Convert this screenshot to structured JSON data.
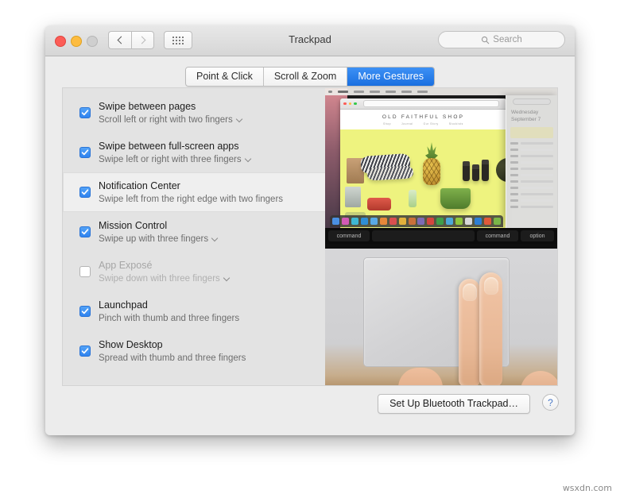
{
  "window": {
    "title": "Trackpad",
    "traffic_lights": [
      "close",
      "minimize",
      "zoom"
    ],
    "toolbar": {
      "back_icon": "chevron-left-icon",
      "forward_icon": "chevron-right-icon",
      "show_all_icon": "grid-icon"
    },
    "search": {
      "placeholder": "Search",
      "icon": "search-icon"
    }
  },
  "tabs": [
    {
      "label": "Point & Click",
      "selected": false
    },
    {
      "label": "Scroll & Zoom",
      "selected": false
    },
    {
      "label": "More Gestures",
      "selected": true
    }
  ],
  "gestures": [
    {
      "title": "Swipe between pages",
      "subtitle": "Scroll left or right with two fingers",
      "checked": true,
      "enabled": true,
      "has_popup": true,
      "selected": false
    },
    {
      "title": "Swipe between full-screen apps",
      "subtitle": "Swipe left or right with three fingers",
      "checked": true,
      "enabled": true,
      "has_popup": true,
      "selected": false
    },
    {
      "title": "Notification Center",
      "subtitle": "Swipe left from the right edge with two fingers",
      "checked": true,
      "enabled": true,
      "has_popup": false,
      "selected": true
    },
    {
      "title": "Mission Control",
      "subtitle": "Swipe up with three fingers",
      "checked": true,
      "enabled": true,
      "has_popup": true,
      "selected": false
    },
    {
      "title": "App Exposé",
      "subtitle": "Swipe down with three fingers",
      "checked": false,
      "enabled": false,
      "has_popup": true,
      "selected": false
    },
    {
      "title": "Launchpad",
      "subtitle": "Pinch with thumb and three fingers",
      "checked": true,
      "enabled": true,
      "has_popup": false,
      "selected": false
    },
    {
      "title": "Show Desktop",
      "subtitle": "Spread with thumb and three fingers",
      "checked": true,
      "enabled": true,
      "has_popup": false,
      "selected": false
    }
  ],
  "preview": {
    "shop_name": "OLD FAITHFUL SHOP",
    "nav_links": [
      "Shop",
      "Journal",
      "Our Story",
      "Stockists"
    ],
    "notification_center": {
      "date_line1": "Wednesday",
      "date_line2": "September 7"
    },
    "keys": {
      "command_left": "command",
      "command_right": "command",
      "option": "option"
    },
    "dock_colors": [
      "#4a90e2",
      "#d35ab5",
      "#3fb8d4",
      "#2f8ed6",
      "#5aa9e6",
      "#e6883a",
      "#d94f4f",
      "#e2b13c",
      "#c9713a",
      "#7d6bb5",
      "#d4463f",
      "#3f9f4a",
      "#4ca8d8",
      "#8fc63d",
      "#d8d8d8",
      "#2e7fd4",
      "#e05a3a",
      "#7ab648"
    ]
  },
  "footer": {
    "setup_button": "Set Up Bluetooth Trackpad…",
    "help_button": "?"
  },
  "watermark": "wsxdn.com",
  "colors": {
    "accent_blue": "#2f83ef",
    "tab_selected": "#2d7ee6",
    "window_bg": "#ececec",
    "panel_bg": "#e3e3e3",
    "row_selected": "#efefef"
  }
}
